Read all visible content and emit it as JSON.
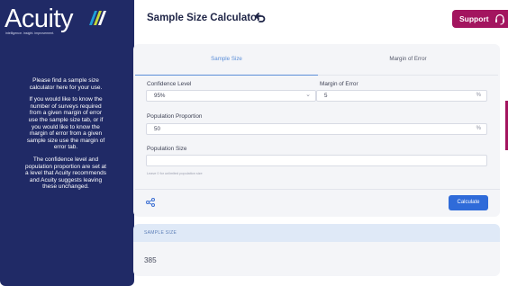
{
  "brand": {
    "name": "Acuity",
    "tagline": "intelligence. insight. improvement."
  },
  "sidebar": {
    "paragraphs": [
      "Please find a sample size calculator here for your use.",
      "If you would like to know the number of surveys required from a given margin of error use the sample size tab, or if you would like to know the margin of error from a given sample size use the margin of error tab.",
      "The confidence level and population proportion are set at a level that Acuity recommends and Acuity suggests leaving these unchanged."
    ]
  },
  "header": {
    "title": "Sample Size Calculator",
    "support_label": "Support"
  },
  "tabs": [
    {
      "label": "Sample Size"
    },
    {
      "label": "Margin of Error"
    }
  ],
  "form": {
    "confidence_label": "Confidence Level",
    "confidence_value": "95%",
    "margin_label": "Margin of Error",
    "margin_value": "5",
    "margin_suffix": "%",
    "proportion_label": "Population Proportion",
    "proportion_value": "50",
    "proportion_suffix": "%",
    "population_label": "Population Size",
    "population_value": "",
    "population_hint": "Leave 0 for unlimited population size"
  },
  "actions": {
    "calculate_label": "Calculate",
    "share_icon": "share-icon"
  },
  "result": {
    "heading": "SAMPLE SIZE",
    "value": "385"
  },
  "colors": {
    "sidebar": "#202a66",
    "accent": "#2f6bd9",
    "support": "#a3155f"
  }
}
